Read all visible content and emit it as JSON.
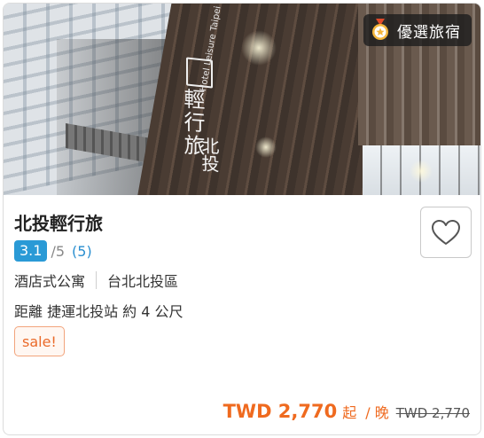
{
  "hero": {
    "sign_chinese_1": "輕行旅",
    "sign_chinese_2": "北投",
    "sign_english": "Hotel Leisure Taipei"
  },
  "badge": {
    "label": "優選旅宿",
    "icon": "award-medal-icon"
  },
  "hotel": {
    "name": "北投輕行旅",
    "rating": "3.1",
    "rating_max": "/5",
    "review_count": "(5)",
    "type": "酒店式公寓",
    "location": "台北北投區",
    "distance": "距離 捷運北投站 約 4 公尺",
    "tag": "sale!"
  },
  "favorite": {
    "icon": "heart-outline-icon"
  },
  "price": {
    "current": "TWD 2,770",
    "qi": "起",
    "per_night": "/ 晚",
    "original": "TWD 2,770"
  },
  "colors": {
    "accent_price": "#ef6a1f",
    "rating_badge": "#2a9ad6",
    "review_link": "#2a8fd0"
  }
}
